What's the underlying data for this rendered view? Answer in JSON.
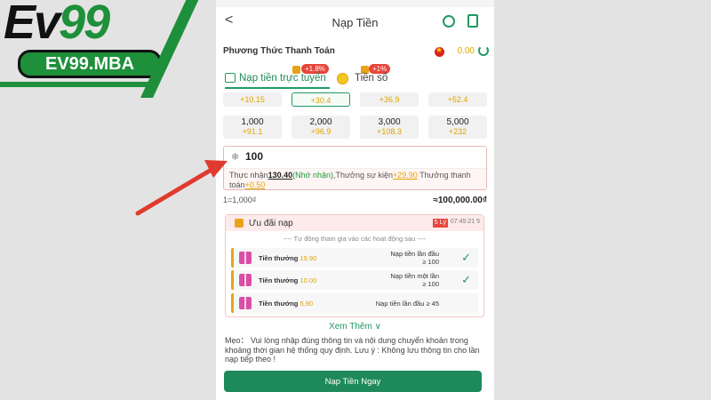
{
  "logo": {
    "brand_main": "Ev",
    "brand_num": "99",
    "domain": "EV99.MBA"
  },
  "header": {
    "back": "<",
    "title": "Nạp Tiền"
  },
  "payment": {
    "title": "Phương Thức Thanh Toán",
    "balance": "0.00"
  },
  "tabs": [
    {
      "label": "Nạp tiền trực tuyến",
      "badge": "+1.8%"
    },
    {
      "label": "Tiền số",
      "badge": "+1%"
    }
  ],
  "amounts_top": [
    {
      "value": "",
      "bonus": "+10.15"
    },
    {
      "value": "",
      "bonus": "+30.4"
    },
    {
      "value": "",
      "bonus": "+36.9"
    },
    {
      "value": "",
      "bonus": "+52.4"
    }
  ],
  "amounts": [
    {
      "value": "1,000",
      "bonus": "+91.1"
    },
    {
      "value": "2,000",
      "bonus": "+96.9"
    },
    {
      "value": "3,000",
      "bonus": "+108.3"
    },
    {
      "value": "5,000",
      "bonus": "+232"
    }
  ],
  "input": {
    "value": "100",
    "recv_prefix": "Thực nhận",
    "recv_amount": "130.40",
    "recv_hint": "(Nhớ nhận)",
    "recv_event": ",Thưởng sự kiện",
    "recv_event_val": "+29.90",
    "recv_pay": " Thưởng thanh toán",
    "recv_pay_val": "+0.50"
  },
  "rate": {
    "left": "1=1,000₫",
    "right": "≈100,000.00₫"
  },
  "promo": {
    "title": "Ưu đãi nạp",
    "timer_badge": "5 Lý",
    "timer": "07:45:21 5",
    "subtitle": "---- Tự động tham gia vào các hoạt động sau ----",
    "items": [
      {
        "label": "Tiền thưởng",
        "value": "19.90",
        "cond1": "Nạp tiền lần đầu",
        "cond2": "≥ 100",
        "check": "✓"
      },
      {
        "label": "Tiền thưởng",
        "value": "10.00",
        "cond1": "Nạp tiền một lần",
        "cond2": "≥ 100",
        "check": "✓"
      },
      {
        "label": "Tiền thưởng",
        "value": "5.90",
        "cond1": "Nạp tiền lần đầu ≥ 45",
        "cond2": "",
        "check": ""
      }
    ]
  },
  "see_more": "Xem Thêm ∨",
  "note": "Mẹo： Vui lòng nhập đúng thông tin và nội dung chuyển khoản trong khoảng thời gian hệ thống quy định. Lưu ý : Không lưu thông tin cho lần nạp tiếp theo !",
  "submit_label": "Nạp Tiền Ngay",
  "colors": {
    "accent": "#1e8a5a",
    "bonus": "#e0a400",
    "arrow": "#e03a2f"
  }
}
